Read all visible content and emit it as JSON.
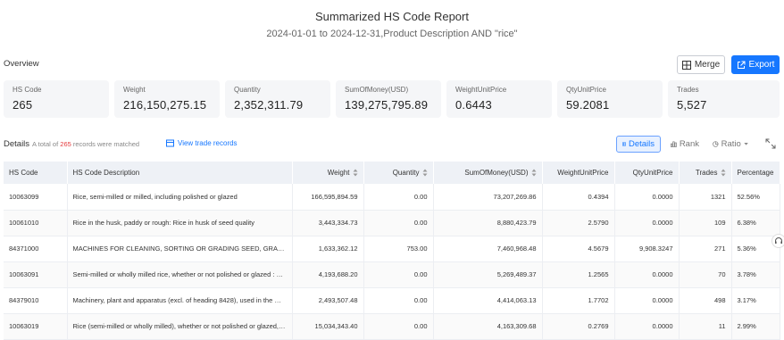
{
  "header": {
    "title": "Summarized HS Code Report",
    "subtitle": "2024-01-01 to 2024-12-31,Product Description AND \"rice\""
  },
  "overview": {
    "label": "Overview",
    "merge_label": "Merge",
    "export_label": "Export",
    "cards": [
      {
        "label": "HS Code",
        "value": "265"
      },
      {
        "label": "Weight",
        "value": "216,150,275.15"
      },
      {
        "label": "Quantity",
        "value": "2,352,311.79"
      },
      {
        "label": "SumOfMoney(USD)",
        "value": "139,275,795.89"
      },
      {
        "label": "WeightUnitPrice",
        "value": "0.6443"
      },
      {
        "label": "QtyUnitPrice",
        "value": "59.2081"
      },
      {
        "label": "Trades",
        "value": "5,527"
      }
    ]
  },
  "details": {
    "label": "Details",
    "meta_prefix": "A total of",
    "meta_count": "265",
    "meta_suffix": "records were matched",
    "view_link": "View trade records",
    "views": {
      "details": "Details",
      "rank": "Rank",
      "ratio": "Ratio"
    }
  },
  "table": {
    "columns": [
      "HS Code",
      "HS Code Description",
      "Weight",
      "Quantity",
      "SumOfMoney(USD)",
      "WeightUnitPrice",
      "QtyUnitPrice",
      "Trades",
      "Percentage"
    ],
    "rows": [
      [
        "10063099",
        "Rice, semi-milled or milled, including polished or glazed",
        "166,595,894.59",
        "0.00",
        "73,207,269.86",
        "0.4394",
        "0.0000",
        "1321",
        "52.56%"
      ],
      [
        "10061010",
        "Rice in the husk, paddy or rough: Rice in husk of seed quality",
        "3,443,334.73",
        "0.00",
        "8,880,423.79",
        "2.5790",
        "0.0000",
        "109",
        "6.38%"
      ],
      [
        "84371000",
        "MACHINES FOR CLEANING, SORTING OR GRADING SEED, GRAIN OR DRIED LEGUMINOUS VEGETABLES",
        "1,633,362.12",
        "753.00",
        "7,460,968.48",
        "4.5679",
        "9,908.3247",
        "271",
        "5.36%"
      ],
      [
        "10063091",
        "Semi-milled or wholly milled rice, whether or not polished or glazed : Semi-milled or wholly milled rice",
        "4,193,688.20",
        "0.00",
        "5,269,489.37",
        "1.2565",
        "0.0000",
        "70",
        "3.78%"
      ],
      [
        "84379010",
        "Machinery, plant and apparatus (excl. of heading 8428), used in the milling or working of cereals",
        "2,493,507.48",
        "0.00",
        "4,414,063.13",
        "1.7702",
        "0.0000",
        "498",
        "3.17%"
      ],
      [
        "10063019",
        "Rice (semi-milled or wholly milled), whether or not polished or glazed, other",
        "15,034,343.40",
        "0.00",
        "4,163,309.68",
        "0.2769",
        "0.0000",
        "11",
        "2.99%"
      ]
    ]
  }
}
